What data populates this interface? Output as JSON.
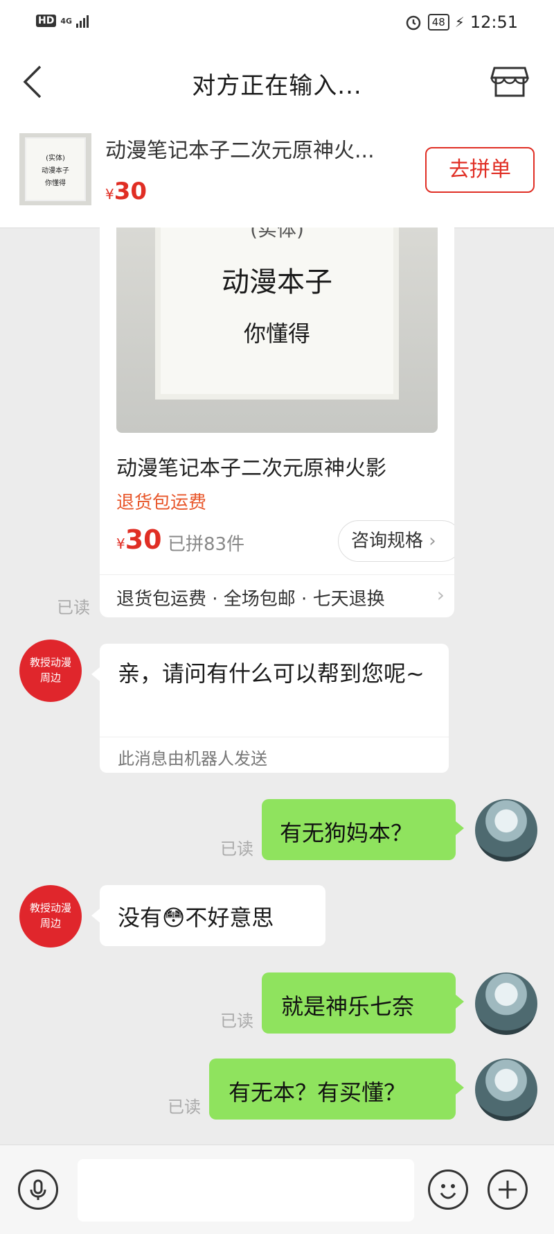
{
  "status_bar": {
    "hd": "HD",
    "network": "4G",
    "battery": "48",
    "time": "12:51"
  },
  "header": {
    "title": "对方正在输入..."
  },
  "product_bar": {
    "thumb_lines": [
      "(实体)",
      "动漫本子",
      "你懂得"
    ],
    "name": "动漫笔记本子二次元原神火...",
    "currency": "¥",
    "price": "30",
    "button": "去拼单"
  },
  "product_card": {
    "image_lines": [
      "(实体)",
      "动漫本子",
      "你懂得"
    ],
    "name": "动漫笔记本子二次元原神火影",
    "return_tag": "退货包运费",
    "currency": "¥",
    "price": "30",
    "sold": "已拼83件",
    "consult": "咨询规格",
    "footer": "退货包运费 · 全场包邮 · 七天退换",
    "read": "已读"
  },
  "messages": [
    {
      "side": "left",
      "avatar": "教授动漫\n周边",
      "text": "亲，请问有什么可以帮到您呢~",
      "note": "此消息由机器人发送"
    },
    {
      "side": "right",
      "text": "有无狗妈本？",
      "read": "已读"
    },
    {
      "side": "left",
      "avatar": "教授动漫\n周边",
      "text_before": "没有",
      "emoji": "😳",
      "text_after": "不好意思"
    },
    {
      "side": "right",
      "text": "就是神乐七奈",
      "read": "已读"
    },
    {
      "side": "right",
      "text": "有无本？有买懂？",
      "read": "已读"
    }
  ],
  "colors": {
    "accent": "#e02e24",
    "bubble_self": "#8fe35e",
    "background": "#ececec"
  }
}
